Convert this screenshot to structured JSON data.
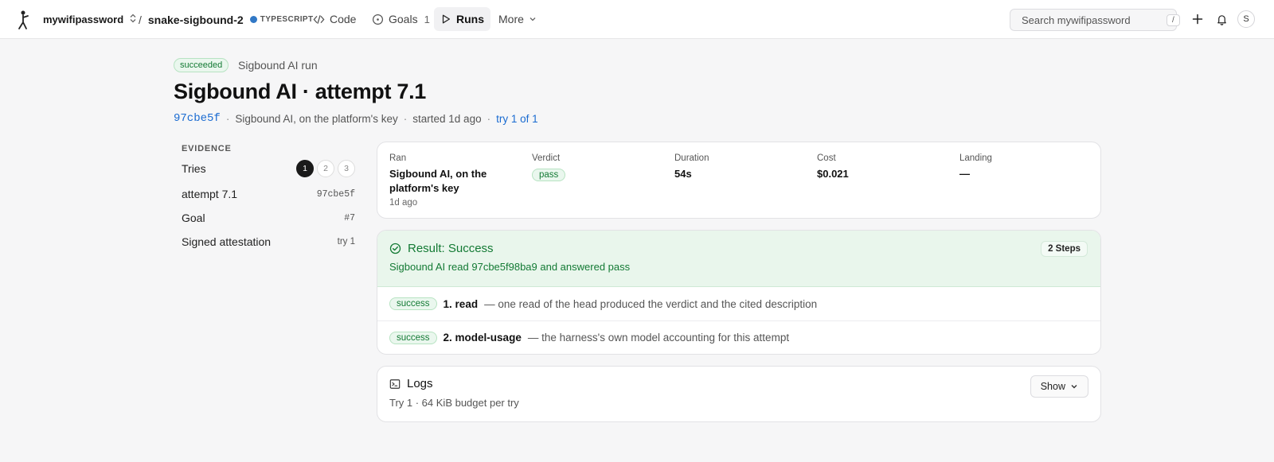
{
  "nav": {
    "org": "mywifipassword",
    "repo": "snake-sigbound-2",
    "language": "TYPESCRIPT",
    "code": "Code",
    "goals": "Goals",
    "goals_count": "1",
    "runs": "Runs",
    "more": "More",
    "search_placeholder": "Search mywifipassword",
    "search_shortcut": "/",
    "avatar": "S"
  },
  "header": {
    "status": "succeeded",
    "kind": "Sigbound AI run",
    "title": "Sigbound AI · attempt 7.1",
    "sha": "97cbe5f",
    "runner": "Sigbound AI, on the platform's key",
    "started": "started 1d ago",
    "try": "try 1 of 1"
  },
  "evidence": {
    "heading": "EVIDENCE",
    "tries_label": "Tries",
    "tries": [
      "1",
      "2",
      "3"
    ],
    "attempt_label": "attempt 7.1",
    "attempt_sha": "97cbe5f",
    "goal_label": "Goal",
    "goal_ref": "#7",
    "attest_label": "Signed attestation",
    "attest_try": "try 1"
  },
  "summary": {
    "ran_label": "Ran",
    "ran_value": "Sigbound AI, on the platform's key",
    "ran_sub": "1d ago",
    "verdict_label": "Verdict",
    "verdict_value": "pass",
    "duration_label": "Duration",
    "duration_value": "54s",
    "cost_label": "Cost",
    "cost_value": "$0.021",
    "landing_label": "Landing",
    "landing_value": "—"
  },
  "result": {
    "title": "Result: Success",
    "subtitle": "Sigbound AI read 97cbe5f98ba9 and answered pass",
    "steps_badge": "2 Steps",
    "steps": [
      {
        "status": "success",
        "name": "1. read",
        "desc": "— one read of the head produced the verdict and the cited description"
      },
      {
        "status": "success",
        "name": "2. model-usage",
        "desc": "— the harness's own model accounting for this attempt"
      }
    ]
  },
  "logs": {
    "title": "Logs",
    "subtitle": "Try 1 · 64 KiB budget per try",
    "show": "Show"
  },
  "colors": {
    "accent_link": "#1a6bd1",
    "success": "#137a34",
    "success_bg": "#e9f6ec",
    "typescript": "#3178c6"
  }
}
